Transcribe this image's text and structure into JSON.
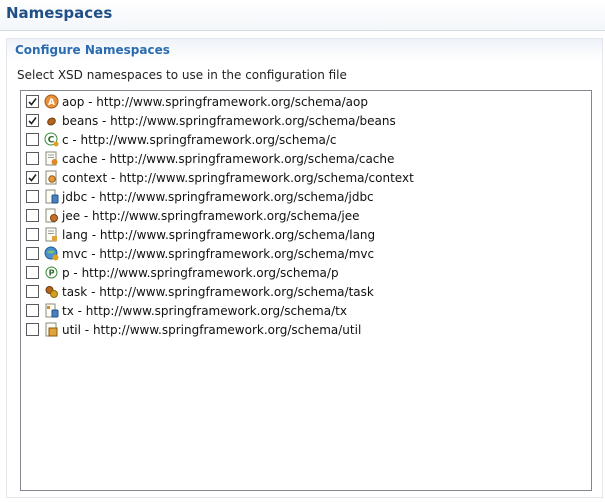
{
  "header": {
    "title": "Namespaces"
  },
  "section": {
    "title": "Configure Namespaces",
    "description": "Select XSD namespaces to use in the configuration file"
  },
  "namespaces": [
    {
      "label": "aop - http://www.springframework.org/schema/aop",
      "checked": true,
      "icon": "aop-icon"
    },
    {
      "label": "beans - http://www.springframework.org/schema/beans",
      "checked": true,
      "icon": "beans-icon"
    },
    {
      "label": "c - http://www.springframework.org/schema/c",
      "checked": false,
      "icon": "c-namespace-icon"
    },
    {
      "label": "cache - http://www.springframework.org/schema/cache",
      "checked": false,
      "icon": "cache-icon"
    },
    {
      "label": "context - http://www.springframework.org/schema/context",
      "checked": true,
      "icon": "context-icon"
    },
    {
      "label": "jdbc - http://www.springframework.org/schema/jdbc",
      "checked": false,
      "icon": "jdbc-icon"
    },
    {
      "label": "jee - http://www.springframework.org/schema/jee",
      "checked": false,
      "icon": "jee-icon"
    },
    {
      "label": "lang - http://www.springframework.org/schema/lang",
      "checked": false,
      "icon": "lang-icon"
    },
    {
      "label": "mvc - http://www.springframework.org/schema/mvc",
      "checked": false,
      "icon": "mvc-icon"
    },
    {
      "label": "p - http://www.springframework.org/schema/p",
      "checked": false,
      "icon": "p-namespace-icon"
    },
    {
      "label": "task - http://www.springframework.org/schema/task",
      "checked": false,
      "icon": "task-icon"
    },
    {
      "label": "tx - http://www.springframework.org/schema/tx",
      "checked": false,
      "icon": "tx-icon"
    },
    {
      "label": "util - http://www.springframework.org/schema/util",
      "checked": false,
      "icon": "util-icon"
    }
  ]
}
